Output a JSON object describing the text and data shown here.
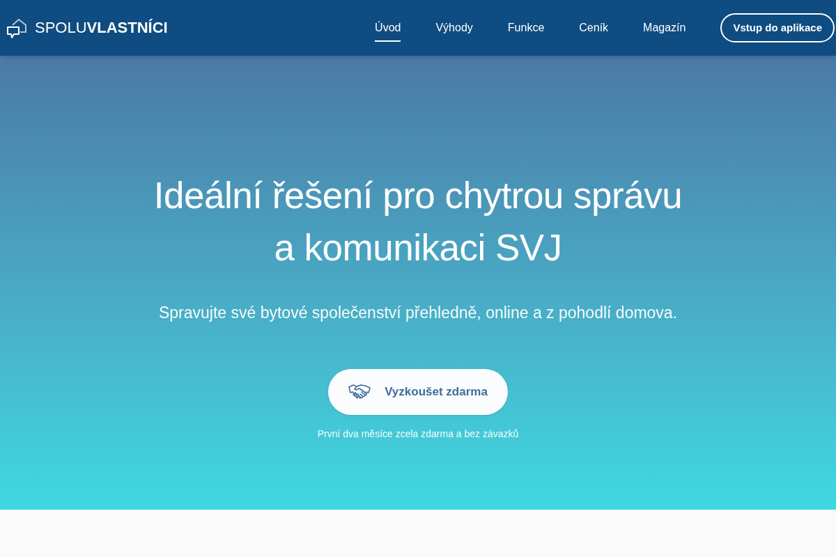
{
  "header": {
    "logo": "SPOLU**VLASTNÍCI**",
    "nav": [
      {
        "label": "Úvod",
        "selected": true
      },
      {
        "label": "Výhody",
        "selected": false
      },
      {
        "label": "Funkce",
        "selected": false
      },
      {
        "label": "Ceník",
        "selected": false
      },
      {
        "label": "Magazín",
        "selected": false
      }
    ],
    "login_button": "Vstup do aplikace"
  },
  "hero": {
    "title_lines": [
      "Ideální řešení pro chytrou správu",
      "a komunikaci SVJ"
    ],
    "subtitle": "Spravujte své bytové společenství přehledně, online a z pohodlí domova.",
    "cta_button": "Vyzkoušet zdarma",
    "note": "První dva měsíce zcela zdarma a bez závazků"
  }
}
